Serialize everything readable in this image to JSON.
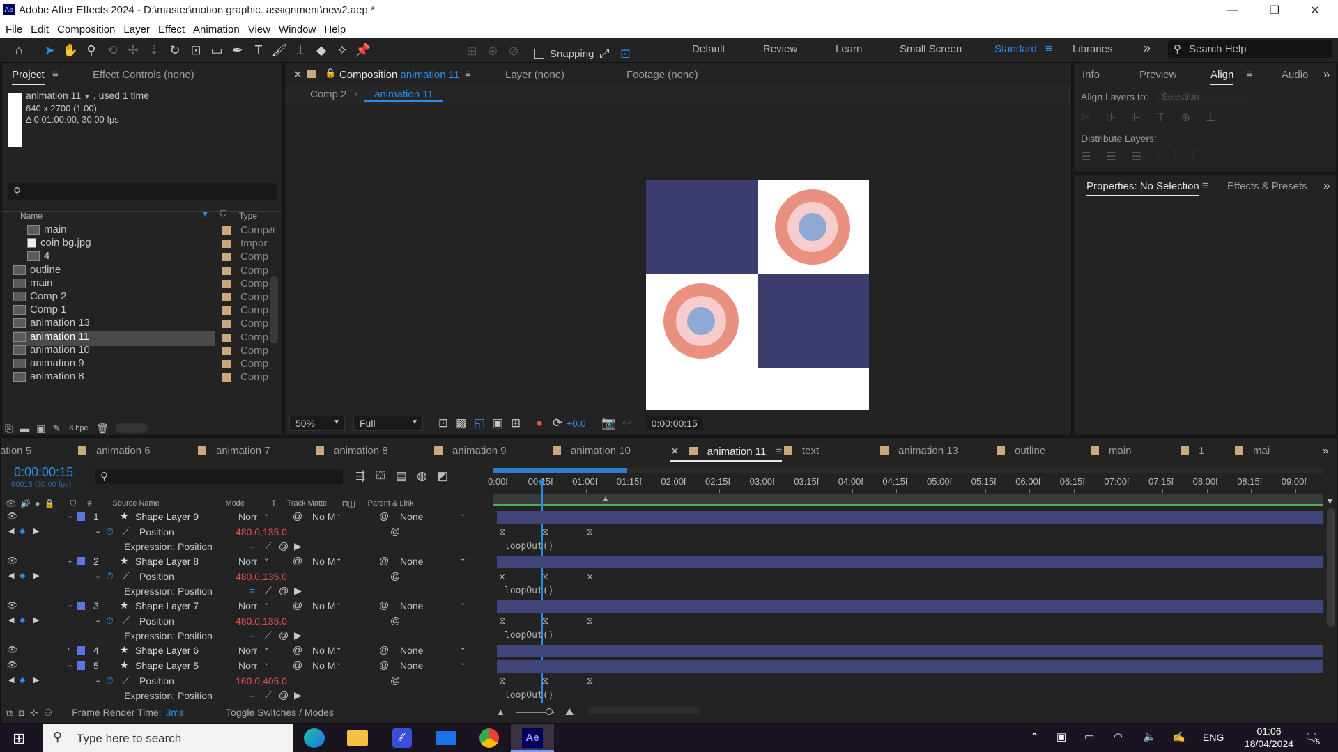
{
  "title_bar": {
    "app_badge": "Ae",
    "title": "Adobe After Effects 2024 - D:\\master\\motion graphic. assignment\\new2.aep *",
    "minimize": "—",
    "restore": "❐",
    "close": "✕"
  },
  "menu": [
    "File",
    "Edit",
    "Composition",
    "Layer",
    "Effect",
    "Animation",
    "View",
    "Window",
    "Help"
  ],
  "toolbar": {
    "snapping_label": "Snapping",
    "workspaces": [
      "Default",
      "Review",
      "Learn",
      "Small Screen",
      "Standard",
      "Libraries"
    ],
    "active_workspace": "Standard",
    "search_placeholder": "Search Help"
  },
  "project_panel": {
    "tabs": [
      "Project",
      "Effect Controls (none)"
    ],
    "selected_item": "animation 11",
    "used_text": ", used 1 time",
    "dimensions": "640 x 2700 (1.00)",
    "duration": "Δ 0:01:00:00, 30.00 fps",
    "col_name": "Name",
    "col_type": "Type",
    "bpc": "8 bpc",
    "items": [
      {
        "name": "main",
        "type": "Comp",
        "indent": true,
        "kind": "comp"
      },
      {
        "name": "coin bg.jpg",
        "type": "Impor",
        "indent": true,
        "kind": "image"
      },
      {
        "name": "4",
        "type": "Comp",
        "indent": true,
        "kind": "comp"
      },
      {
        "name": "outline",
        "type": "Comp",
        "indent": false,
        "kind": "comp"
      },
      {
        "name": "main",
        "type": "Comp",
        "indent": false,
        "kind": "comp"
      },
      {
        "name": "Comp 2",
        "type": "Comp",
        "indent": false,
        "kind": "comp"
      },
      {
        "name": "Comp 1",
        "type": "Comp",
        "indent": false,
        "kind": "comp"
      },
      {
        "name": "animation 13",
        "type": "Comp",
        "indent": false,
        "kind": "comp"
      },
      {
        "name": "animation 11",
        "type": "Comp",
        "indent": false,
        "kind": "comp",
        "selected": true
      },
      {
        "name": "animation 10",
        "type": "Comp",
        "indent": false,
        "kind": "comp"
      },
      {
        "name": "animation 9",
        "type": "Comp",
        "indent": false,
        "kind": "comp"
      },
      {
        "name": "animation 8",
        "type": "Comp",
        "indent": false,
        "kind": "comp"
      }
    ]
  },
  "comp_panel": {
    "tab_prefix": "Composition",
    "tab_comp": "animation 11",
    "layer_tab": "Layer  (none)",
    "footage_tab": "Footage  (none)",
    "breadcrumb_parent": "Comp 2",
    "breadcrumb_current": "animation 11",
    "zoom": "50%",
    "resolution": "Full",
    "exposure": "+0.0",
    "timecode": "0:00:00:15",
    "colors": {
      "navy": "#3c3d6e",
      "coral": "#e99080",
      "pink": "#f6cccc",
      "blue": "#8fa8d4",
      "white": "#ffffff"
    }
  },
  "right_panel": {
    "tabs": [
      "Info",
      "Preview",
      "Align",
      "Audio"
    ],
    "align_layers_to": "Align Layers to:",
    "align_target": "Selection",
    "distribute_layers": "Distribute Layers:",
    "properties_tab": "Properties: No Selection",
    "effects_tab": "Effects & Presets"
  },
  "timeline": {
    "tabs": [
      "ation 5",
      "animation 6",
      "animation 7",
      "animation 8",
      "animation 9",
      "animation 10",
      "animation 11",
      "text",
      "animation 13",
      "outline",
      "main",
      "1",
      "mai"
    ],
    "active_tab": "animation 11",
    "timecode": "0:00:00:15",
    "frame_info": "00015 (30.00 fps)",
    "col_source": "Source Name",
    "col_mode": "Mode",
    "col_t": "T",
    "col_trackmatte": "Track Matte",
    "col_parent": "Parent & Link",
    "ruler": [
      "0:00f",
      "00:15f",
      "01:00f",
      "01:15f",
      "02:00f",
      "02:15f",
      "03:00f",
      "03:15f",
      "04:00f",
      "04:15f",
      "05:00f",
      "05:15f",
      "06:00f",
      "06:15f",
      "07:00f",
      "07:15f",
      "08:00f",
      "08:15f",
      "09:00f"
    ],
    "layers": [
      {
        "num": "1",
        "name": "Shape Layer 9",
        "mode": "Norr",
        "matte": "No M",
        "parent": "None",
        "position": "480.0,135.0",
        "expr_label": "Expression: Position",
        "expr": "loopOut()"
      },
      {
        "num": "2",
        "name": "Shape Layer 8",
        "mode": "Norr",
        "matte": "No M",
        "parent": "None",
        "position": "480.0,135.0",
        "expr_label": "Expression: Position",
        "expr": "loopOut()"
      },
      {
        "num": "3",
        "name": "Shape Layer 7",
        "mode": "Norr",
        "matte": "No M",
        "parent": "None",
        "position": "480.0,135.0",
        "expr_label": "Expression: Position",
        "expr": "loopOut()"
      },
      {
        "num": "4",
        "name": "Shape Layer 6",
        "mode": "Norr",
        "matte": "No M",
        "parent": "None"
      },
      {
        "num": "5",
        "name": "Shape Layer 5",
        "mode": "Norr",
        "matte": "No M",
        "parent": "None",
        "position": "160.0,405.0",
        "expr_label": "Expression: Position",
        "expr": "loopOut()"
      }
    ],
    "position_label": "Position",
    "frame_render_label": "Frame Render Time:",
    "frame_render_value": "3ms",
    "toggle_label": "Toggle Switches / Modes",
    "layer_color": "#3f4579",
    "playhead_color": "#2d8ceb"
  },
  "taskbar": {
    "search_placeholder": "Type here to search",
    "language": "ENG",
    "time": "01:06",
    "date": "18/04/2024",
    "notif_count": "5"
  }
}
